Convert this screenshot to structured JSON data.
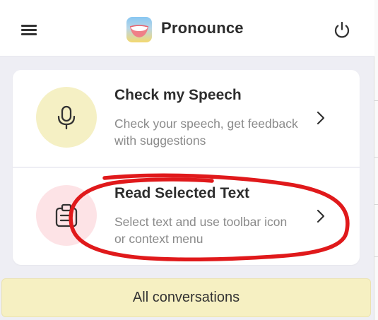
{
  "header": {
    "app_title": "Pronounce",
    "menu_icon": "hamburger-menu-icon",
    "logo_icon": "smiling-mouth-logo",
    "power_icon": "power-icon"
  },
  "options": [
    {
      "title": "Check my Speech",
      "description": "Check your speech, get feedback with suggestions",
      "icon": "microphone-icon",
      "icon_bg": "#f5f0c4"
    },
    {
      "title": "Read Selected Text",
      "description": "Select text and use toolbar icon or context menu",
      "icon": "clipboard-text-icon",
      "icon_bg": "#fde3e6"
    }
  ],
  "footer": {
    "button_label": "All conversations"
  },
  "colors": {
    "annotation": "#e0191b",
    "footer_bg": "#f6f0c2"
  }
}
